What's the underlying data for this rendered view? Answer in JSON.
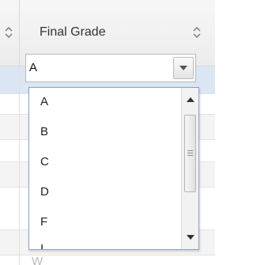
{
  "column": {
    "title": "Final Grade",
    "sort_icon": "sort-updown-icon",
    "prev_sort_icon": "sort-updown-icon"
  },
  "combo": {
    "value": "A",
    "arrow_icon": "chevron-down-icon"
  },
  "dropdown": {
    "options": [
      "A",
      "B",
      "C",
      "D",
      "F",
      "I"
    ]
  },
  "below_row_text": "W",
  "colors": {
    "selected_row": "#dbe6f4",
    "dropdown_border": "#8aa1c4",
    "header_bg": "#efefef"
  }
}
